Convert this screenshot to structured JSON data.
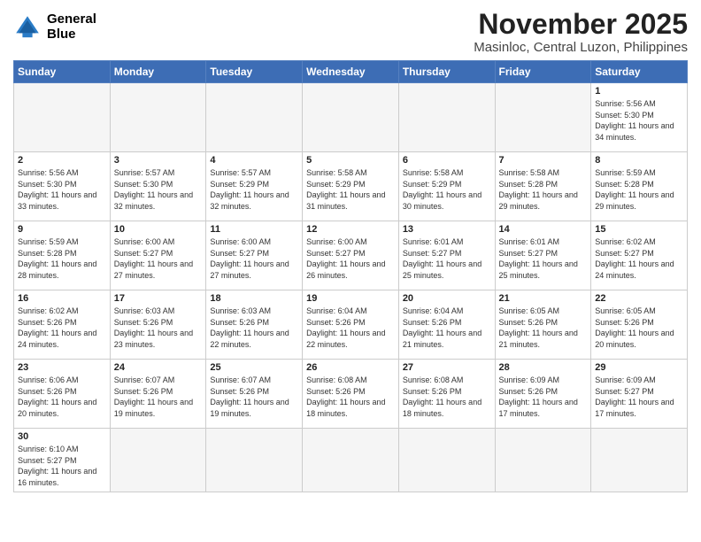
{
  "header": {
    "logo": {
      "line1": "General",
      "line2": "Blue"
    },
    "title": "November 2025",
    "location": "Masinloc, Central Luzon, Philippines"
  },
  "weekdays": [
    "Sunday",
    "Monday",
    "Tuesday",
    "Wednesday",
    "Thursday",
    "Friday",
    "Saturday"
  ],
  "days": [
    {
      "num": "",
      "empty": true
    },
    {
      "num": "",
      "empty": true
    },
    {
      "num": "",
      "empty": true
    },
    {
      "num": "",
      "empty": true
    },
    {
      "num": "",
      "empty": true
    },
    {
      "num": "",
      "empty": true
    },
    {
      "num": "1",
      "sunrise": "5:56 AM",
      "sunset": "5:30 PM",
      "daylight": "11 hours and 34 minutes."
    },
    {
      "num": "2",
      "sunrise": "5:56 AM",
      "sunset": "5:30 PM",
      "daylight": "11 hours and 33 minutes."
    },
    {
      "num": "3",
      "sunrise": "5:57 AM",
      "sunset": "5:30 PM",
      "daylight": "11 hours and 32 minutes."
    },
    {
      "num": "4",
      "sunrise": "5:57 AM",
      "sunset": "5:29 PM",
      "daylight": "11 hours and 32 minutes."
    },
    {
      "num": "5",
      "sunrise": "5:58 AM",
      "sunset": "5:29 PM",
      "daylight": "11 hours and 31 minutes."
    },
    {
      "num": "6",
      "sunrise": "5:58 AM",
      "sunset": "5:29 PM",
      "daylight": "11 hours and 30 minutes."
    },
    {
      "num": "7",
      "sunrise": "5:58 AM",
      "sunset": "5:28 PM",
      "daylight": "11 hours and 29 minutes."
    },
    {
      "num": "8",
      "sunrise": "5:59 AM",
      "sunset": "5:28 PM",
      "daylight": "11 hours and 29 minutes."
    },
    {
      "num": "9",
      "sunrise": "5:59 AM",
      "sunset": "5:28 PM",
      "daylight": "11 hours and 28 minutes."
    },
    {
      "num": "10",
      "sunrise": "6:00 AM",
      "sunset": "5:27 PM",
      "daylight": "11 hours and 27 minutes."
    },
    {
      "num": "11",
      "sunrise": "6:00 AM",
      "sunset": "5:27 PM",
      "daylight": "11 hours and 27 minutes."
    },
    {
      "num": "12",
      "sunrise": "6:00 AM",
      "sunset": "5:27 PM",
      "daylight": "11 hours and 26 minutes."
    },
    {
      "num": "13",
      "sunrise": "6:01 AM",
      "sunset": "5:27 PM",
      "daylight": "11 hours and 25 minutes."
    },
    {
      "num": "14",
      "sunrise": "6:01 AM",
      "sunset": "5:27 PM",
      "daylight": "11 hours and 25 minutes."
    },
    {
      "num": "15",
      "sunrise": "6:02 AM",
      "sunset": "5:27 PM",
      "daylight": "11 hours and 24 minutes."
    },
    {
      "num": "16",
      "sunrise": "6:02 AM",
      "sunset": "5:26 PM",
      "daylight": "11 hours and 24 minutes."
    },
    {
      "num": "17",
      "sunrise": "6:03 AM",
      "sunset": "5:26 PM",
      "daylight": "11 hours and 23 minutes."
    },
    {
      "num": "18",
      "sunrise": "6:03 AM",
      "sunset": "5:26 PM",
      "daylight": "11 hours and 22 minutes."
    },
    {
      "num": "19",
      "sunrise": "6:04 AM",
      "sunset": "5:26 PM",
      "daylight": "11 hours and 22 minutes."
    },
    {
      "num": "20",
      "sunrise": "6:04 AM",
      "sunset": "5:26 PM",
      "daylight": "11 hours and 21 minutes."
    },
    {
      "num": "21",
      "sunrise": "6:05 AM",
      "sunset": "5:26 PM",
      "daylight": "11 hours and 21 minutes."
    },
    {
      "num": "22",
      "sunrise": "6:05 AM",
      "sunset": "5:26 PM",
      "daylight": "11 hours and 20 minutes."
    },
    {
      "num": "23",
      "sunrise": "6:06 AM",
      "sunset": "5:26 PM",
      "daylight": "11 hours and 20 minutes."
    },
    {
      "num": "24",
      "sunrise": "6:07 AM",
      "sunset": "5:26 PM",
      "daylight": "11 hours and 19 minutes."
    },
    {
      "num": "25",
      "sunrise": "6:07 AM",
      "sunset": "5:26 PM",
      "daylight": "11 hours and 19 minutes."
    },
    {
      "num": "26",
      "sunrise": "6:08 AM",
      "sunset": "5:26 PM",
      "daylight": "11 hours and 18 minutes."
    },
    {
      "num": "27",
      "sunrise": "6:08 AM",
      "sunset": "5:26 PM",
      "daylight": "11 hours and 18 minutes."
    },
    {
      "num": "28",
      "sunrise": "6:09 AM",
      "sunset": "5:26 PM",
      "daylight": "11 hours and 17 minutes."
    },
    {
      "num": "29",
      "sunrise": "6:09 AM",
      "sunset": "5:27 PM",
      "daylight": "11 hours and 17 minutes."
    },
    {
      "num": "30",
      "sunrise": "6:10 AM",
      "sunset": "5:27 PM",
      "daylight": "11 hours and 16 minutes."
    },
    {
      "num": "",
      "empty": true
    },
    {
      "num": "",
      "empty": true
    },
    {
      "num": "",
      "empty": true
    },
    {
      "num": "",
      "empty": true
    },
    {
      "num": "",
      "empty": true
    },
    {
      "num": "",
      "empty": true
    }
  ]
}
